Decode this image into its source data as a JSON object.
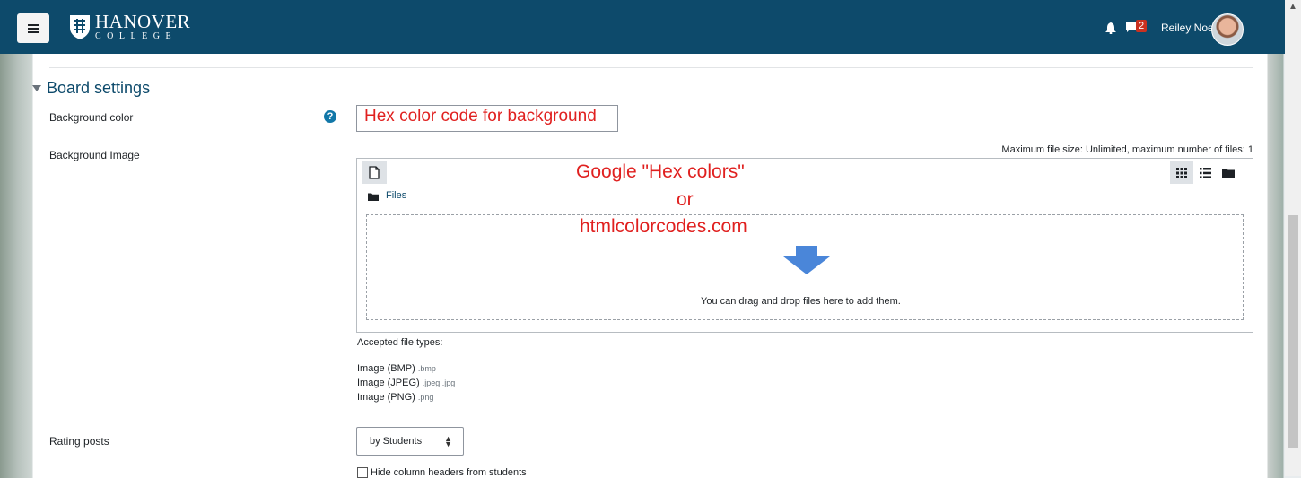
{
  "navbar": {
    "logo_line1": "HANOVER",
    "logo_line2": "COLLEGE",
    "notification_count": "2",
    "username": "Reiley Noe"
  },
  "section": {
    "title": "Board settings"
  },
  "fields": {
    "background_color_label": "Background color",
    "background_color_annotation": "Hex color code  for background",
    "background_image_label": "Background Image",
    "max_file_info": "Maximum file size: Unlimited, maximum number of files: 1",
    "files_label": "Files",
    "annotation_line1": "Google \"Hex colors\"",
    "annotation_line2": "or",
    "annotation_line3": "htmlcolorcodes.com",
    "drop_text": "You can drag and drop files here to add them.",
    "accepted_label": "Accepted file types:",
    "file_types": [
      {
        "name": "Image (BMP)",
        "ext": ".bmp"
      },
      {
        "name": "Image (JPEG)",
        "ext": ".jpeg .jpg"
      },
      {
        "name": "Image (PNG)",
        "ext": ".png"
      }
    ],
    "rating_label": "Rating posts",
    "rating_value": "by Students",
    "hide_headers_label": "Hide column headers from students"
  },
  "colors": {
    "navbar_bg": "#0d4a6b",
    "annotation_red": "#e0201f",
    "accent": "#1177a8",
    "arrow_blue": "#4a86d9"
  },
  "icons": [
    "hamburger-icon",
    "logo-shield-icon",
    "bell-icon",
    "chat-icon",
    "help-icon",
    "new-file-icon",
    "grid-view-icon",
    "list-view-icon",
    "folder-view-icon",
    "folder-icon",
    "drop-arrow-icon",
    "sort-caret-icon"
  ]
}
